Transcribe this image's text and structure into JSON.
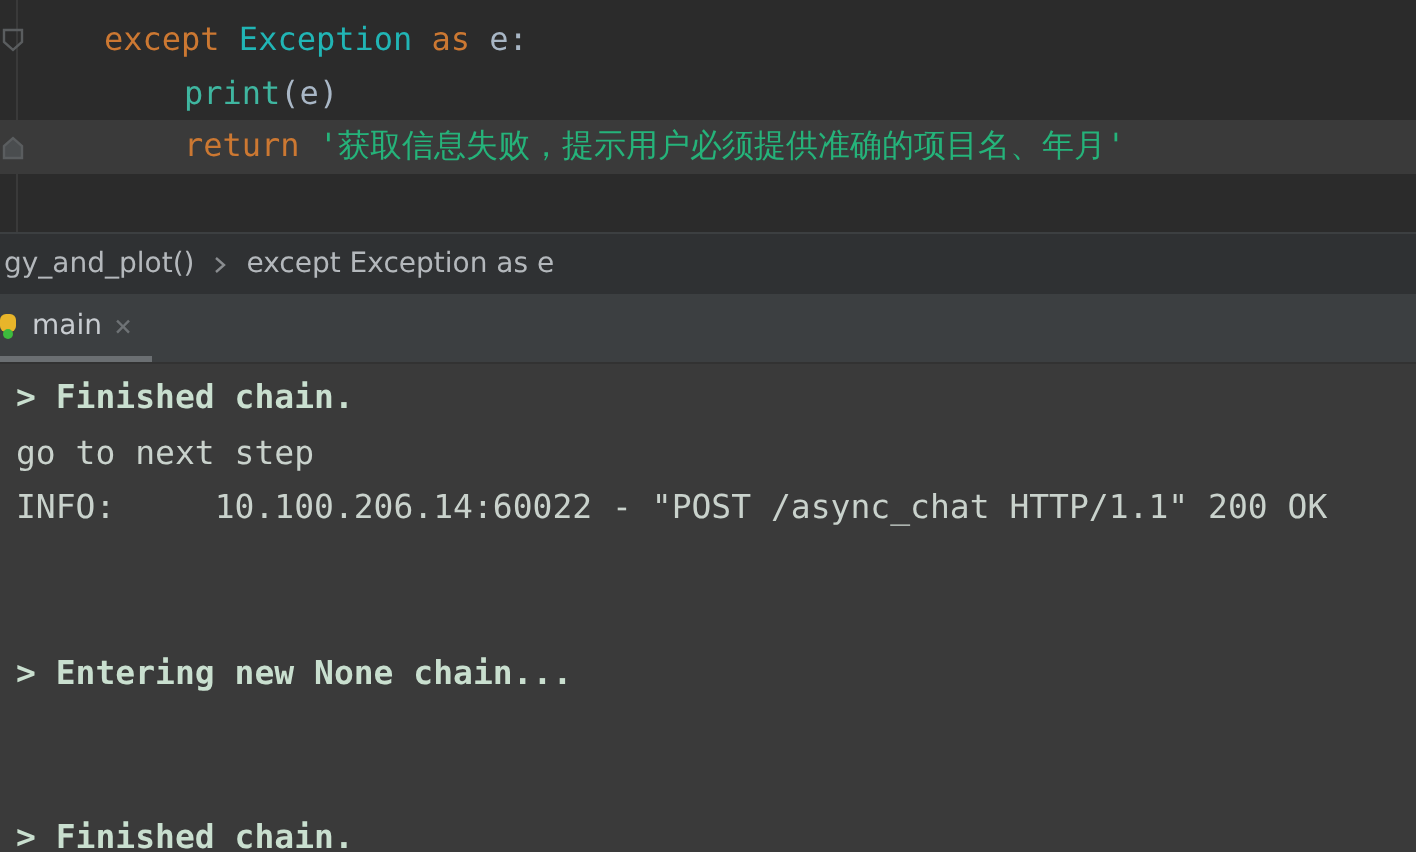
{
  "editor": {
    "lines": [
      {
        "fold_start": true,
        "current": false,
        "tokens": [
          {
            "kind": "keyword",
            "text": "except"
          },
          {
            "kind": "class",
            "text": " Exception"
          },
          {
            "kind": "keyword",
            "text": " as"
          },
          {
            "kind": "plain",
            "text": " e:"
          }
        ],
        "children": [
          {
            "current": false,
            "tokens": [
              {
                "kind": "builtin",
                "text": "print"
              },
              {
                "kind": "plain",
                "text": "(e)"
              }
            ]
          },
          {
            "fold_end": true,
            "current": true,
            "tokens": [
              {
                "kind": "keyword",
                "text": "return"
              },
              {
                "kind": "string",
                "text": " '获取信息失败，提示用户必须提供准确的项目名、年月'"
              }
            ]
          }
        ]
      }
    ]
  },
  "breadcrumbs": [
    "gy_and_plot()",
    "except Exception as e"
  ],
  "run_tabs": [
    {
      "label": "main",
      "selected": true,
      "close": "×"
    }
  ],
  "console": {
    "lines": [
      {
        "kind": "chain",
        "text": "> Finished chain."
      },
      {
        "kind": "plain",
        "text": "go to next step"
      },
      {
        "kind": "plain",
        "text": "INFO:     10.100.206.14:60022 - \"POST /async_chat HTTP/1.1\" 200 OK"
      },
      {
        "kind": "blank"
      },
      {
        "kind": "blank"
      },
      {
        "kind": "chain",
        "text": "> Entering new None chain..."
      },
      {
        "kind": "blank"
      },
      {
        "kind": "blank"
      },
      {
        "kind": "chain",
        "text": "> Finished chain."
      }
    ]
  }
}
